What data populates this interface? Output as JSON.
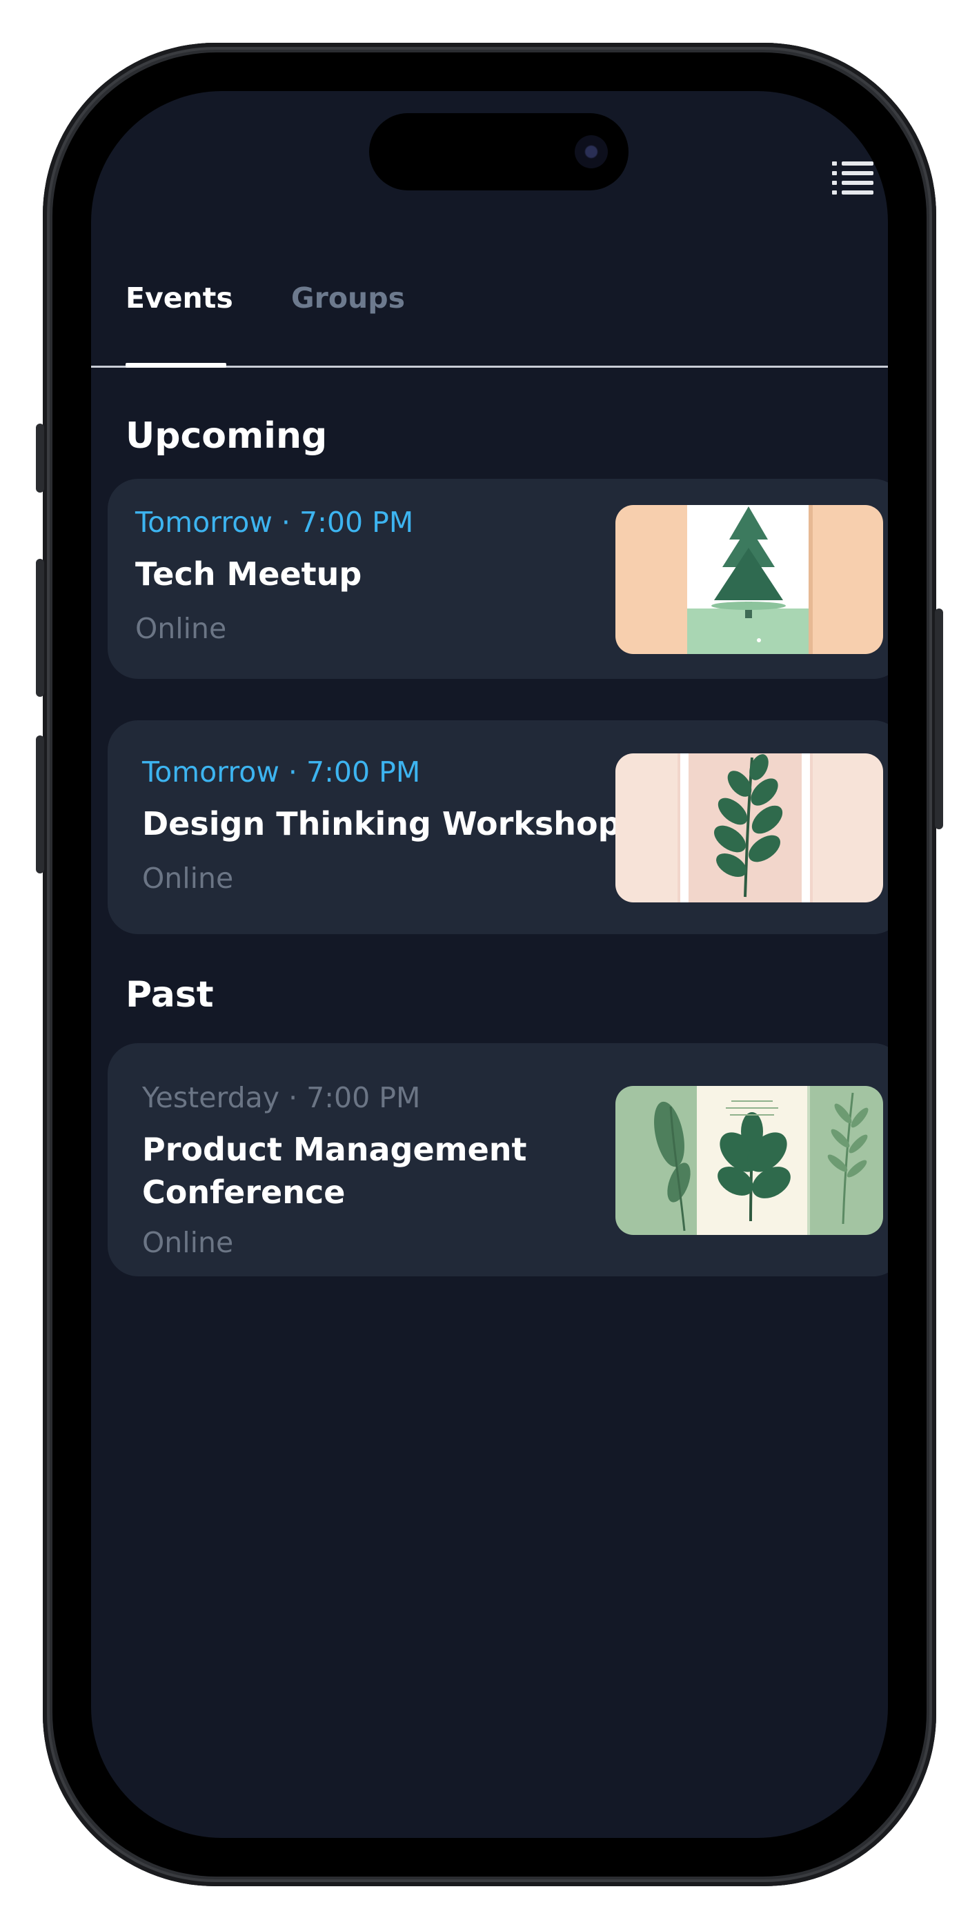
{
  "tabs": [
    {
      "label": "Events",
      "active": true
    },
    {
      "label": "Groups",
      "active": false
    }
  ],
  "icons": {
    "menu": "list-menu-icon"
  },
  "colors": {
    "background": "#131826",
    "card": "#212938",
    "accent": "#3db4f0",
    "muted": "#6b7585"
  },
  "sections": {
    "upcoming": {
      "heading": "Upcoming",
      "events": [
        {
          "when": "Tomorrow · 7:00 PM",
          "title": "Tech Meetup",
          "location": "Online",
          "thumbnail": "pine-tree-illustration"
        },
        {
          "when": "Tomorrow · 7:00 PM",
          "title": "Design Thinking Workshop",
          "location": "Online",
          "thumbnail": "leaf-branch-illustration"
        }
      ]
    },
    "past": {
      "heading": "Past",
      "events": [
        {
          "when": "Yesterday · 7:00 PM",
          "title_line1": "Product Management",
          "title_line2": "Conference",
          "location": "Online",
          "thumbnail": "botanical-leaves-illustration"
        }
      ]
    }
  }
}
